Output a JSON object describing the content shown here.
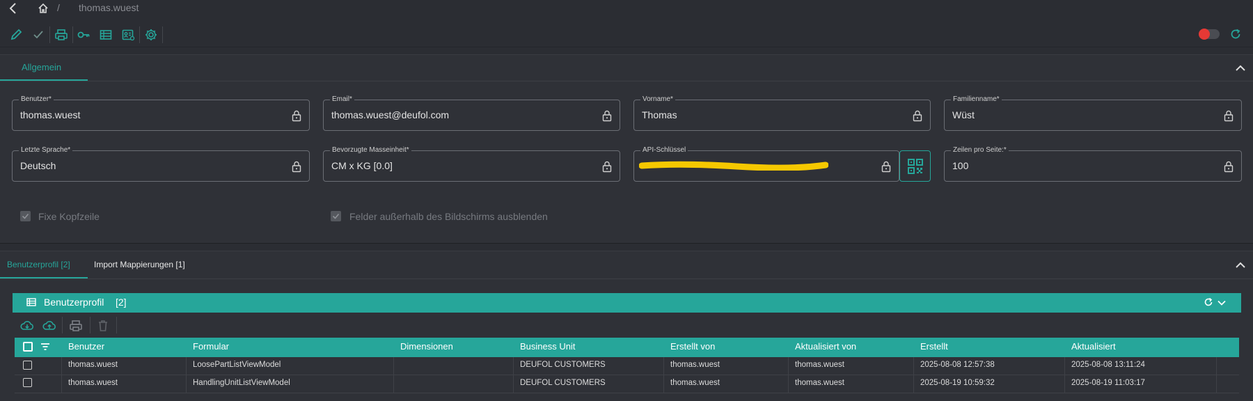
{
  "breadcrumb": {
    "separator": "/",
    "current": "thomas.wuest"
  },
  "toolbar": {
    "icons": [
      "pencil-icon",
      "check-icon",
      "print-icon",
      "key-icon",
      "table-icon",
      "id-card-icon",
      "gear-icon"
    ],
    "toggle_color": "#e53935"
  },
  "general": {
    "tab_label": "Allgemein",
    "fields": {
      "benutzer": {
        "label": "Benutzer*",
        "value": "thomas.wuest"
      },
      "email": {
        "label": "Email*",
        "value": "thomas.wuest@deufol.com"
      },
      "vorname": {
        "label": "Vorname*",
        "value": "Thomas"
      },
      "familienname": {
        "label": "Familienname*",
        "value": "Wüst"
      },
      "sprache": {
        "label": "Letzte Sprache*",
        "value": "Deutsch"
      },
      "masseinheit": {
        "label": "Bevorzugte Masseinheit*",
        "value": "CM x KG [0.0]"
      },
      "api": {
        "label": "API-Schlüssel",
        "value": ""
      },
      "zeilen": {
        "label": "Zeilen pro Seite:*",
        "value": "100"
      }
    },
    "checkboxes": {
      "fixe_kopfzeile": "Fixe Kopfzeile",
      "felder_ausblenden": "Felder außerhalb des Bildschirms ausblenden"
    }
  },
  "detail_tabs": {
    "benutzerprofil": "Benutzerprofil [2]",
    "import": "Import Mappierungen [1]"
  },
  "grid": {
    "title": "Benutzerprofil",
    "count": "[2]",
    "columns": [
      "Benutzer",
      "Formular",
      "Dimensionen",
      "Business Unit",
      "Erstellt von",
      "Aktualisiert von",
      "Erstellt",
      "Aktualisiert"
    ],
    "rows": [
      [
        "thomas.wuest",
        "LoosePartListViewModel",
        "",
        "DEUFOL CUSTOMERS",
        "thomas.wuest",
        "thomas.wuest",
        "2025-08-08 12:57:38",
        "2025-08-08 13:11:24"
      ],
      [
        "thomas.wuest",
        "HandlingUnitListViewModel",
        "",
        "DEUFOL CUSTOMERS",
        "thomas.wuest",
        "thomas.wuest",
        "2025-08-19 10:59:32",
        "2025-08-19 11:03:17"
      ]
    ]
  },
  "colors": {
    "accent": "#26a69a",
    "background": "#2b2d33",
    "panel": "#2f3137"
  }
}
